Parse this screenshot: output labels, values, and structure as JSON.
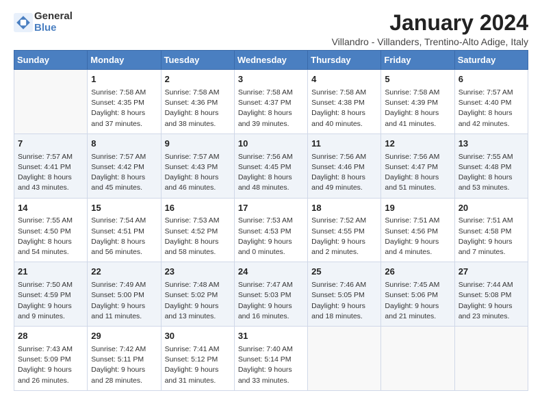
{
  "header": {
    "logo_line1": "General",
    "logo_line2": "Blue",
    "title": "January 2024",
    "subtitle": "Villandro - Villanders, Trentino-Alto Adige, Italy"
  },
  "calendar": {
    "days_of_week": [
      "Sunday",
      "Monday",
      "Tuesday",
      "Wednesday",
      "Thursday",
      "Friday",
      "Saturday"
    ],
    "weeks": [
      [
        {
          "day": "",
          "info": ""
        },
        {
          "day": "1",
          "info": "Sunrise: 7:58 AM\nSunset: 4:35 PM\nDaylight: 8 hours\nand 37 minutes."
        },
        {
          "day": "2",
          "info": "Sunrise: 7:58 AM\nSunset: 4:36 PM\nDaylight: 8 hours\nand 38 minutes."
        },
        {
          "day": "3",
          "info": "Sunrise: 7:58 AM\nSunset: 4:37 PM\nDaylight: 8 hours\nand 39 minutes."
        },
        {
          "day": "4",
          "info": "Sunrise: 7:58 AM\nSunset: 4:38 PM\nDaylight: 8 hours\nand 40 minutes."
        },
        {
          "day": "5",
          "info": "Sunrise: 7:58 AM\nSunset: 4:39 PM\nDaylight: 8 hours\nand 41 minutes."
        },
        {
          "day": "6",
          "info": "Sunrise: 7:57 AM\nSunset: 4:40 PM\nDaylight: 8 hours\nand 42 minutes."
        }
      ],
      [
        {
          "day": "7",
          "info": "Sunrise: 7:57 AM\nSunset: 4:41 PM\nDaylight: 8 hours\nand 43 minutes."
        },
        {
          "day": "8",
          "info": "Sunrise: 7:57 AM\nSunset: 4:42 PM\nDaylight: 8 hours\nand 45 minutes."
        },
        {
          "day": "9",
          "info": "Sunrise: 7:57 AM\nSunset: 4:43 PM\nDaylight: 8 hours\nand 46 minutes."
        },
        {
          "day": "10",
          "info": "Sunrise: 7:56 AM\nSunset: 4:45 PM\nDaylight: 8 hours\nand 48 minutes."
        },
        {
          "day": "11",
          "info": "Sunrise: 7:56 AM\nSunset: 4:46 PM\nDaylight: 8 hours\nand 49 minutes."
        },
        {
          "day": "12",
          "info": "Sunrise: 7:56 AM\nSunset: 4:47 PM\nDaylight: 8 hours\nand 51 minutes."
        },
        {
          "day": "13",
          "info": "Sunrise: 7:55 AM\nSunset: 4:48 PM\nDaylight: 8 hours\nand 53 minutes."
        }
      ],
      [
        {
          "day": "14",
          "info": "Sunrise: 7:55 AM\nSunset: 4:50 PM\nDaylight: 8 hours\nand 54 minutes."
        },
        {
          "day": "15",
          "info": "Sunrise: 7:54 AM\nSunset: 4:51 PM\nDaylight: 8 hours\nand 56 minutes."
        },
        {
          "day": "16",
          "info": "Sunrise: 7:53 AM\nSunset: 4:52 PM\nDaylight: 8 hours\nand 58 minutes."
        },
        {
          "day": "17",
          "info": "Sunrise: 7:53 AM\nSunset: 4:53 PM\nDaylight: 9 hours\nand 0 minutes."
        },
        {
          "day": "18",
          "info": "Sunrise: 7:52 AM\nSunset: 4:55 PM\nDaylight: 9 hours\nand 2 minutes."
        },
        {
          "day": "19",
          "info": "Sunrise: 7:51 AM\nSunset: 4:56 PM\nDaylight: 9 hours\nand 4 minutes."
        },
        {
          "day": "20",
          "info": "Sunrise: 7:51 AM\nSunset: 4:58 PM\nDaylight: 9 hours\nand 7 minutes."
        }
      ],
      [
        {
          "day": "21",
          "info": "Sunrise: 7:50 AM\nSunset: 4:59 PM\nDaylight: 9 hours\nand 9 minutes."
        },
        {
          "day": "22",
          "info": "Sunrise: 7:49 AM\nSunset: 5:00 PM\nDaylight: 9 hours\nand 11 minutes."
        },
        {
          "day": "23",
          "info": "Sunrise: 7:48 AM\nSunset: 5:02 PM\nDaylight: 9 hours\nand 13 minutes."
        },
        {
          "day": "24",
          "info": "Sunrise: 7:47 AM\nSunset: 5:03 PM\nDaylight: 9 hours\nand 16 minutes."
        },
        {
          "day": "25",
          "info": "Sunrise: 7:46 AM\nSunset: 5:05 PM\nDaylight: 9 hours\nand 18 minutes."
        },
        {
          "day": "26",
          "info": "Sunrise: 7:45 AM\nSunset: 5:06 PM\nDaylight: 9 hours\nand 21 minutes."
        },
        {
          "day": "27",
          "info": "Sunrise: 7:44 AM\nSunset: 5:08 PM\nDaylight: 9 hours\nand 23 minutes."
        }
      ],
      [
        {
          "day": "28",
          "info": "Sunrise: 7:43 AM\nSunset: 5:09 PM\nDaylight: 9 hours\nand 26 minutes."
        },
        {
          "day": "29",
          "info": "Sunrise: 7:42 AM\nSunset: 5:11 PM\nDaylight: 9 hours\nand 28 minutes."
        },
        {
          "day": "30",
          "info": "Sunrise: 7:41 AM\nSunset: 5:12 PM\nDaylight: 9 hours\nand 31 minutes."
        },
        {
          "day": "31",
          "info": "Sunrise: 7:40 AM\nSunset: 5:14 PM\nDaylight: 9 hours\nand 33 minutes."
        },
        {
          "day": "",
          "info": ""
        },
        {
          "day": "",
          "info": ""
        },
        {
          "day": "",
          "info": ""
        }
      ]
    ]
  }
}
